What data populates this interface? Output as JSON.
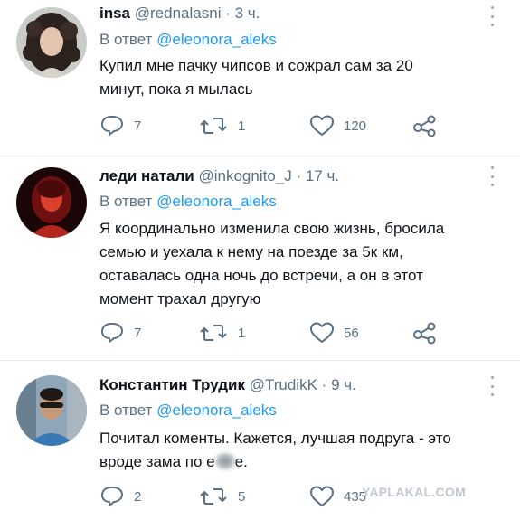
{
  "tweets": [
    {
      "name": "insa",
      "handle": "@rednalasni",
      "sep": "·",
      "time": "3 ч.",
      "reply_prefix": "В ответ",
      "reply_to": "@eleonora_aleks",
      "text_lines": [
        "Купил мне пачку чипсов и сожрал сам за 20",
        "минут, пока я мылась"
      ],
      "replies": "7",
      "retweets": "1",
      "likes": "120"
    },
    {
      "name": "леди натали",
      "handle": "@inkognito_J",
      "sep": "·",
      "time": "17 ч.",
      "reply_prefix": "В ответ",
      "reply_to": "@eleonora_aleks",
      "text_lines": [
        "Я координально изменила свою жизнь, бросила",
        "семью и уехала к нему на поезде за 5к км,",
        "оставалась одна ночь до встречи, а он в этот",
        "момент трахал другую"
      ],
      "replies": "7",
      "retweets": "1",
      "likes": "56"
    },
    {
      "name": "Константин Трудик",
      "handle": "@TrudikK",
      "sep": "·",
      "time": "9 ч.",
      "reply_prefix": "В ответ",
      "reply_to": "@eleonora_aleks",
      "text_lines": [
        "Почитал коменты. Кажется, лучшая подруга - это",
        "вроде зама по е",
        "е."
      ],
      "replies": "2",
      "retweets": "5",
      "likes": "435"
    }
  ],
  "watermark": "YAPLAKAL.COM",
  "colors": {
    "mention": "#1d9bf0",
    "muted": "#5b7083",
    "text": "#0f1419",
    "divider": "#e6ecf0"
  },
  "icons": [
    "reply-icon",
    "retweet-icon",
    "like-icon",
    "share-icon",
    "more-icon"
  ]
}
